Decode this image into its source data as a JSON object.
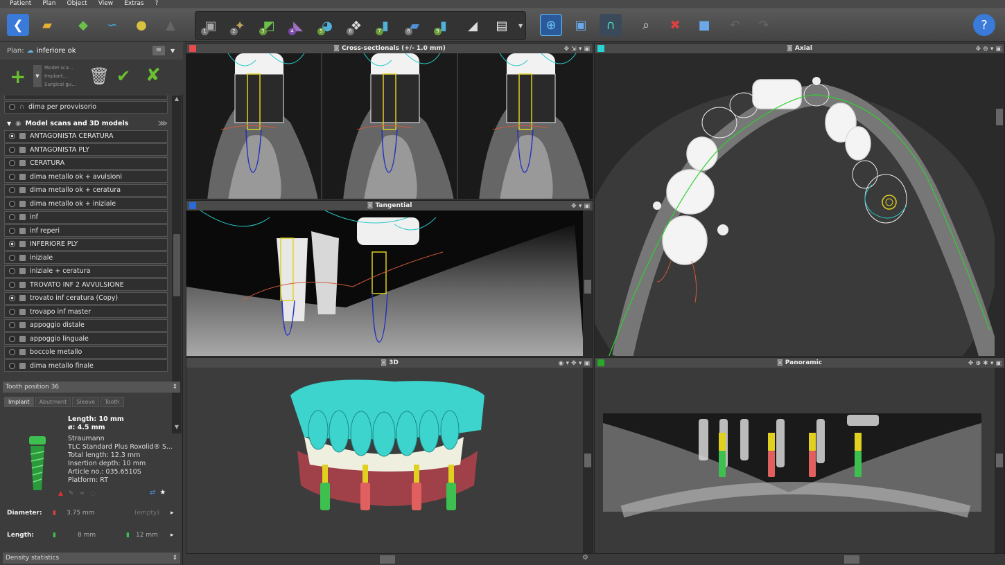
{
  "menu": [
    "Patient",
    "Plan",
    "Object",
    "View",
    "Extras",
    "?"
  ],
  "plan": {
    "label": "Plan:",
    "name": "inferiore ok",
    "tool_labels": [
      "Model sca...",
      "Implant...",
      "Surgical gu..."
    ]
  },
  "tree": {
    "top_item": "dima per provvisorio",
    "section_title": "Model scans and 3D models",
    "items": [
      {
        "label": "ANTAGONISTA CERATURA",
        "on": true
      },
      {
        "label": "ANTAGONISTA PLY",
        "on": false
      },
      {
        "label": "CERATURA",
        "on": false
      },
      {
        "label": "dima metallo ok + avulsioni",
        "on": false
      },
      {
        "label": "dima metallo ok + ceratura",
        "on": false
      },
      {
        "label": "dima metallo ok + iniziale",
        "on": false
      },
      {
        "label": "inf",
        "on": false
      },
      {
        "label": "inf reperi",
        "on": false
      },
      {
        "label": "INFERIORE PLY",
        "on": true
      },
      {
        "label": "iniziale",
        "on": false
      },
      {
        "label": "iniziale + ceratura",
        "on": false
      },
      {
        "label": "TROVATO INF 2 AVVULSIONE",
        "on": false
      },
      {
        "label": "trovato inf ceratura (Copy)",
        "on": true
      },
      {
        "label": "trovapo inf master",
        "on": false
      },
      {
        "label": "appoggio distale",
        "on": false
      },
      {
        "label": "appoggio linguale",
        "on": false
      },
      {
        "label": "boccole metallo",
        "on": false
      },
      {
        "label": "dima metallo finale",
        "on": false
      }
    ]
  },
  "tooth": {
    "header": "Tooth position 36",
    "tabs": [
      "Implant",
      "Abutment",
      "Sleeve",
      "Tooth"
    ],
    "length": "Length: 10 mm",
    "diameter_text": "ø: 4.5 mm",
    "brand": "Straumann",
    "model": "TLC Standard Plus Roxolid® S...",
    "total_length": "Total length: 12.3 mm",
    "insertion": "Insertion depth: 10 mm",
    "article": "Article no.: 035.6510S",
    "platform": "Platform: RT",
    "diameter_label": "Diameter:",
    "diameter_val1": "3.75 mm",
    "diameter_val2": "(empty)",
    "length_label": "Length:",
    "length_val1": "8 mm",
    "length_val2": "12 mm"
  },
  "density": "Density statistics",
  "views": {
    "cross": "Cross-sectionals (+/- 1.0 mm)",
    "axial": "Axial",
    "tangential": "Tangential",
    "three_d": "3D",
    "panoramic": "Panoramic"
  },
  "colors": {
    "cross_swatch": "#e84a4a",
    "axial_swatch": "#28d4d4",
    "tangential_swatch": "#2a6ad8",
    "pan_swatch": "#2aa82a",
    "implant_yellow": "#e0d020",
    "implant_blue": "#2030c0",
    "model_cyan": "#3cd4cc"
  }
}
